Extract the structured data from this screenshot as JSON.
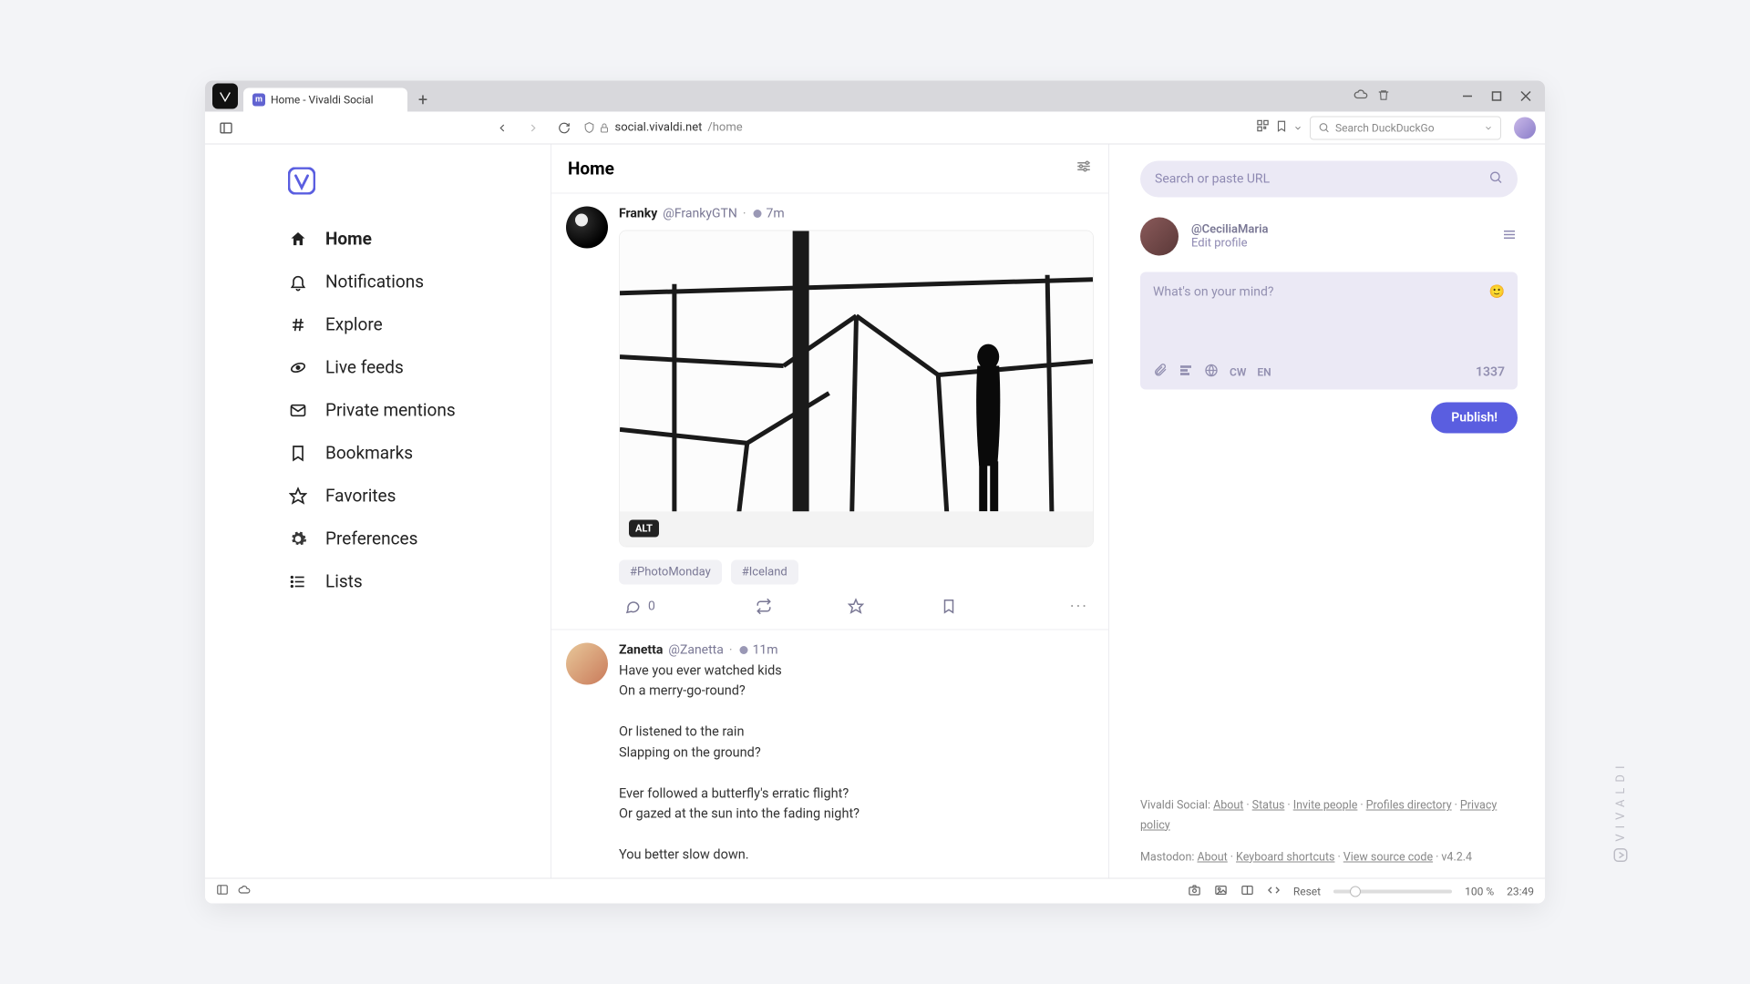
{
  "browser": {
    "tab_title": "Home - Vivaldi Social",
    "url_host": "social.vivaldi.net",
    "url_path": "/home",
    "search_placeholder": "Search DuckDuckGo"
  },
  "nav": {
    "items": [
      {
        "label": "Home",
        "active": true
      },
      {
        "label": "Notifications"
      },
      {
        "label": "Explore"
      },
      {
        "label": "Live feeds"
      },
      {
        "label": "Private mentions"
      },
      {
        "label": "Bookmarks"
      },
      {
        "label": "Favorites"
      },
      {
        "label": "Preferences"
      },
      {
        "label": "Lists"
      }
    ]
  },
  "feed": {
    "title": "Home",
    "posts": [
      {
        "displayname": "Franky",
        "handle": "@FrankyGTN",
        "time": "7m",
        "alt_badge": "ALT",
        "tags": [
          "#PhotoMonday",
          "#Iceland"
        ],
        "reply_count": "0"
      },
      {
        "displayname": "Zanetta",
        "handle": "@Zanetta",
        "time": "11m",
        "text": "Have you ever watched kids\nOn a merry-go-round?\n\nOr listened to the rain\nSlapping on the ground?\n\nEver followed a butterfly's erratic flight?\nOr gazed at the sun into the fading night?\n\nYou better slow down."
      }
    ]
  },
  "sidebar": {
    "search_placeholder": "Search or paste URL",
    "user_handle": "@CeciliaMaria",
    "edit_profile": "Edit profile",
    "compose_placeholder": "What's on your mind?",
    "cw_label": "CW",
    "lang_label": "EN",
    "char_count": "1337",
    "publish_label": "Publish!"
  },
  "footer": {
    "vivaldi_label": "Vivaldi Social",
    "vivaldi_links": [
      "About",
      "Status",
      "Invite people",
      "Profiles directory",
      "Privacy policy"
    ],
    "mastodon_label": "Mastodon",
    "mastodon_links": [
      "About",
      "Keyboard shortcuts",
      "View source code"
    ],
    "version": "v4.2.4"
  },
  "statusbar": {
    "reset": "Reset",
    "zoom": "100 %",
    "clock": "23:49"
  },
  "brand": "VIVALDI"
}
